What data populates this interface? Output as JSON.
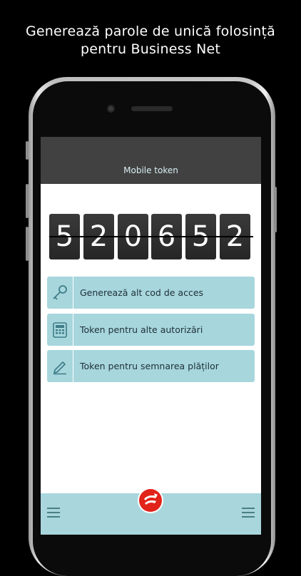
{
  "headline": {
    "line1": "Generează parole de unică folosință",
    "line2": "pentru Business Net"
  },
  "header": {
    "title": "Mobile token"
  },
  "token": {
    "digits": [
      "5",
      "2",
      "0",
      "6",
      "5",
      "2"
    ]
  },
  "actions": [
    {
      "label": "Generează alt cod de acces",
      "icon": "key-icon"
    },
    {
      "label": "Token pentru alte autorizări",
      "icon": "calculator-icon"
    },
    {
      "label": "Token pentru semnarea plăților",
      "icon": "pen-icon"
    }
  ],
  "bottom_bar": {
    "left_icon": "menu-icon",
    "center_icon": "unicredit-logo",
    "right_icon": "menu-icon"
  },
  "colors": {
    "topbar": "#414141",
    "button_bg": "#a7d6dd",
    "bottom_bar": "#a9d6dc",
    "logo_red": "#e2231a"
  }
}
